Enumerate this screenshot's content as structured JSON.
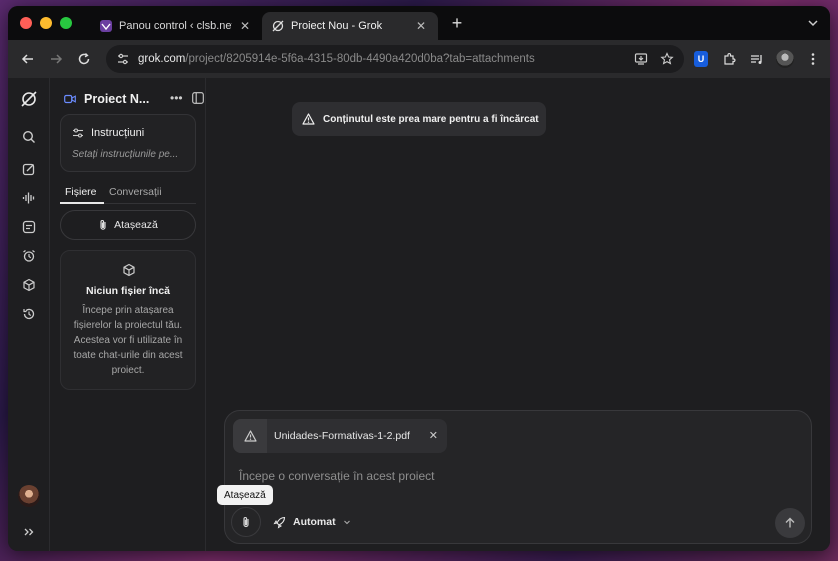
{
  "browser": {
    "tabs": [
      {
        "title": "Panou control ‹ clsb.net — W...",
        "icon": "wp-icon",
        "active": false
      },
      {
        "title": "Proiect Nou - Grok",
        "icon": "grok-icon",
        "active": true
      }
    ],
    "new_tab_label": "+",
    "url_host": "grok.com",
    "url_path": "/project/8205914e-5f6a-4315-80db-4490a420d0ba?tab=attachments"
  },
  "project": {
    "name": "Proiect N...",
    "instructions_title": "Instrucțiuni",
    "instructions_placeholder": "Setați instrucțiunile pe...",
    "tabs": [
      {
        "label": "Fișiere",
        "active": true
      },
      {
        "label": "Conversații",
        "active": false
      }
    ],
    "attach_label": "Atașează",
    "empty_title": "Niciun fișier încă",
    "empty_text": "Începe prin atașarea fișierelor la proiectul tău. Acestea vor fi utilizate în toate chat-urile din acest proiect."
  },
  "toast": {
    "message": "Conținutul este prea mare pentru a fi încărcat"
  },
  "composer": {
    "file_name": "Unidades-Formativas-1-2.pdf",
    "placeholder": "Începe o conversație în acest proiect",
    "model_label": "Automat",
    "tooltip": "Atașează"
  },
  "colors": {
    "background": "#1e1e20",
    "accent_text": "#f0f0f0"
  }
}
